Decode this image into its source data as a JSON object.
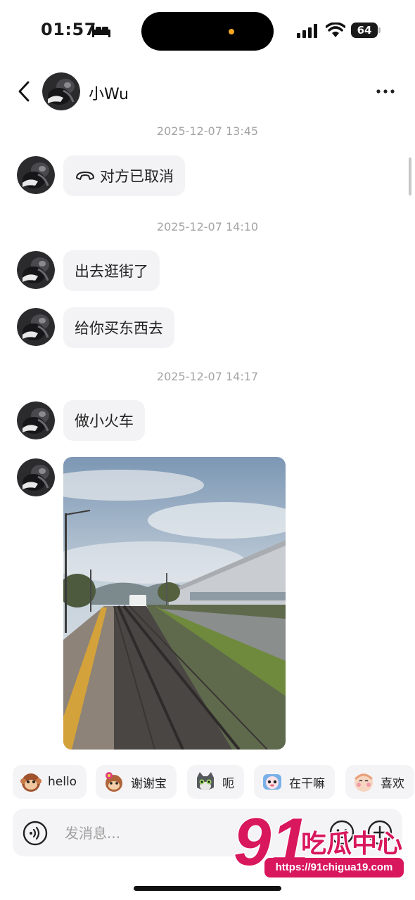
{
  "status_bar": {
    "time": "01:57",
    "battery": "64",
    "island_dot_color": "#f5a623"
  },
  "header": {
    "contact_name": "小Wu",
    "back_icon": "chevron-left-icon",
    "more_icon": "more-horizontal-icon"
  },
  "messages": {
    "ts1": "2025-12-07 13:45",
    "call_cancelled": "对方已取消",
    "ts2": "2025-12-07 14:10",
    "m1": "出去逛街了",
    "m2": "给你买东西去",
    "ts3": "2025-12-07 14:17",
    "m3": "做小火车"
  },
  "quick_replies": [
    {
      "label": "hello",
      "emoji": "monkey-emoji"
    },
    {
      "label": "谢谢宝",
      "emoji": "flower-monkey-emoji"
    },
    {
      "label": "呃",
      "emoji": "cat-emoji"
    },
    {
      "label": "在干嘛",
      "emoji": "peeking-emoji"
    },
    {
      "label": "喜欢",
      "emoji": "blushing-emoji"
    }
  ],
  "input": {
    "placeholder": "发消息..."
  },
  "watermark": {
    "logo_number": "91",
    "logo_text": "吃瓜中心",
    "url": "https://91chigua19.com",
    "color": "#d8175c"
  },
  "colors": {
    "bubble": "#f3f3f5",
    "timestamp": "#a3a3a3"
  }
}
